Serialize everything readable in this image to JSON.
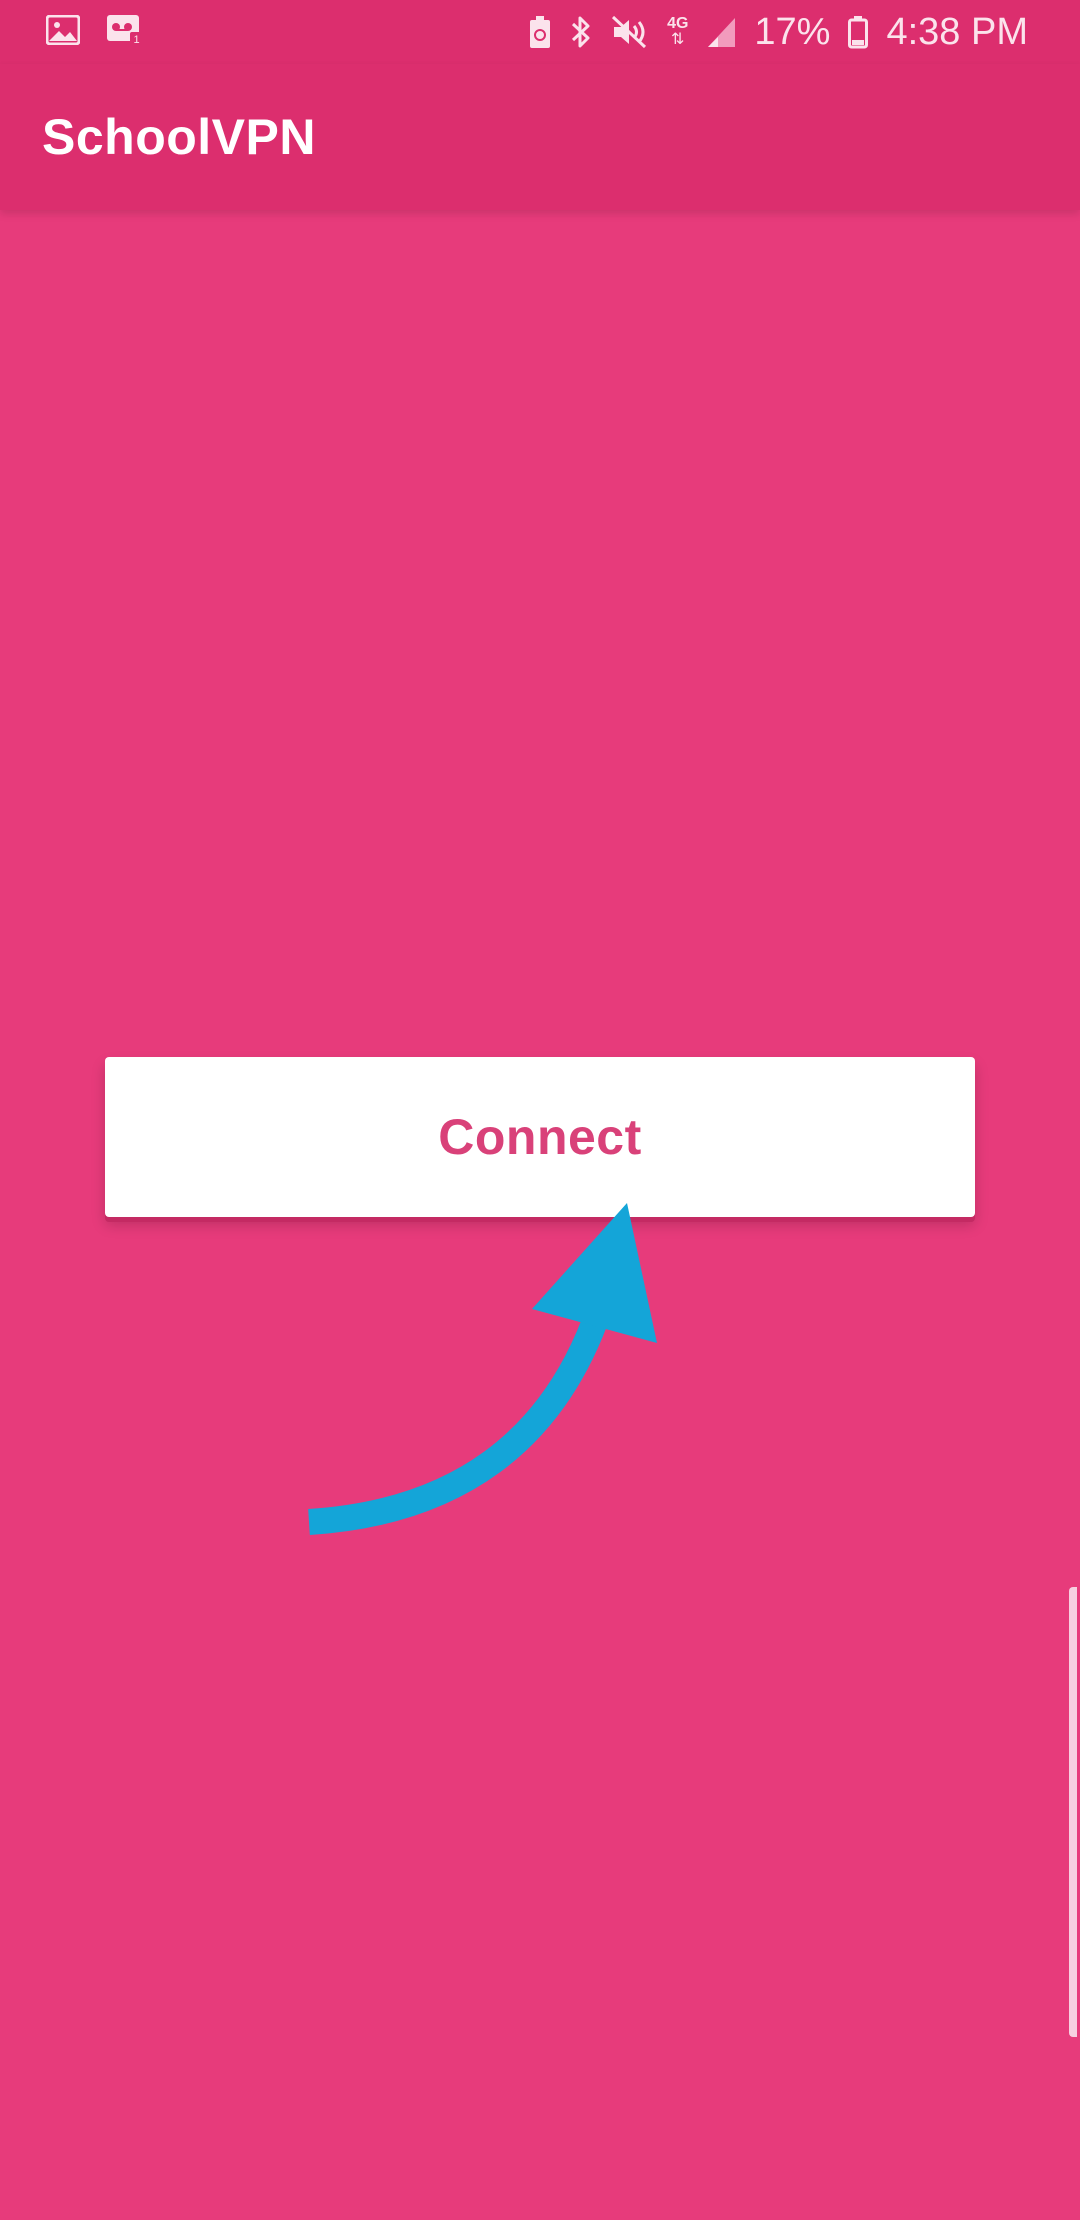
{
  "status_bar": {
    "left_icons": [
      "gallery-icon",
      "voicemail-icon"
    ],
    "right_icons": [
      "battery-saver-icon",
      "bluetooth-icon",
      "mute-icon",
      "network-4g-icon",
      "signal-icon",
      "battery-icon"
    ],
    "network_type": "4G",
    "battery_percent": "17%",
    "time": "4:38 PM"
  },
  "app_bar": {
    "title": "SchoolVPN"
  },
  "main": {
    "connect_button_label": "Connect"
  },
  "colors": {
    "background": "#e73b7b",
    "app_bar": "#dc2e6e",
    "button_text": "#d94179",
    "arrow": "#14a5d8"
  },
  "annotation": {
    "icon": "curved-arrow-icon"
  }
}
